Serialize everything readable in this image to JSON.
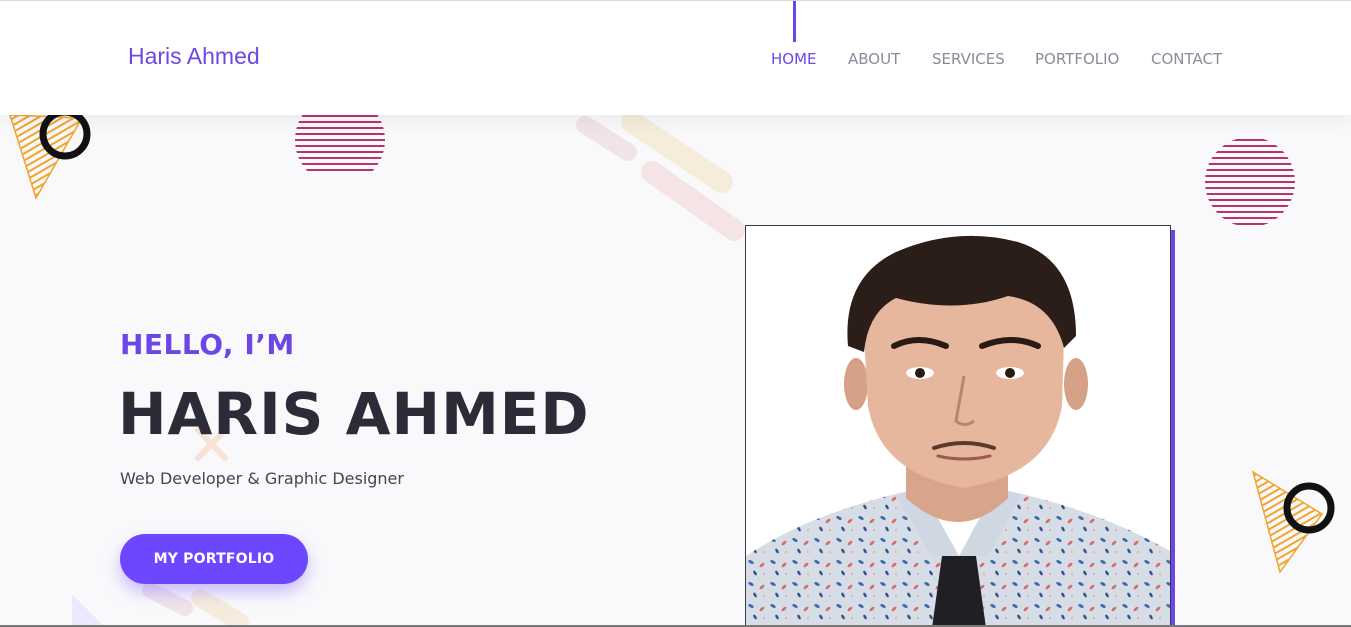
{
  "brand": {
    "name": "Haris Ahmed"
  },
  "nav": {
    "items": [
      {
        "label": "HOME",
        "active": true
      },
      {
        "label": "ABOUT"
      },
      {
        "label": "SERVICES"
      },
      {
        "label": "PORTFOLIO"
      },
      {
        "label": "CONTACT"
      }
    ]
  },
  "hero": {
    "greeting": "HELLO, I’M",
    "name": "HARIS AHMED",
    "subtitle": "Web Developer & Graphic Designer",
    "cta_label": "MY PORTFOLIO"
  },
  "colors": {
    "accent": "#6c47e6",
    "button": "#6c47ff",
    "heading": "#2c2c39",
    "decor_stripe": "#b8336a",
    "decor_triangle": "#f2a52e"
  },
  "icons": {
    "portrait": "profile-photo"
  }
}
